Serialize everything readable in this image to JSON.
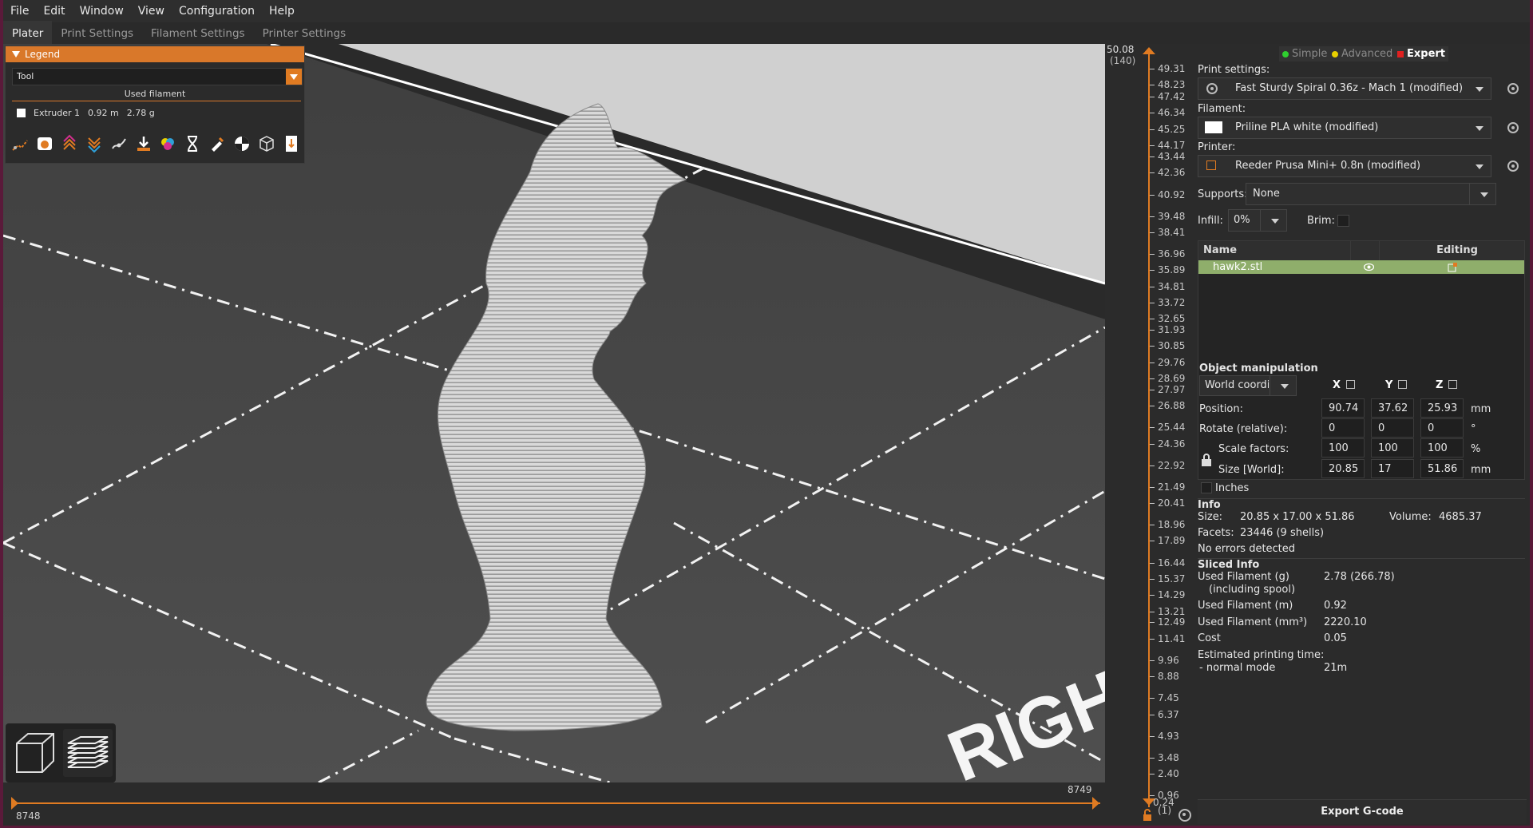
{
  "menu": [
    "File",
    "Edit",
    "Window",
    "View",
    "Configuration",
    "Help"
  ],
  "tabs": [
    "Plater",
    "Print Settings",
    "Filament Settings",
    "Printer Settings"
  ],
  "legend": {
    "title": "Legend",
    "view_type": "Tool",
    "used_filament_label": "Used filament",
    "extruder": {
      "name": "Extruder 1",
      "length": "0.92 m",
      "weight": "2.78 g",
      "color": "#ffffff"
    },
    "icons": [
      "travel-icon",
      "wipe-icon",
      "retractions-icon",
      "deretractions-icon",
      "seams-icon",
      "tool-changes-icon",
      "color-changes-icon",
      "pause-prints-icon",
      "custom-gcodes-icon",
      "center-of-gravity-icon",
      "shells-icon",
      "tool-marker-icon"
    ]
  },
  "viewport": {
    "bed_text": "RIGH"
  },
  "horizontal_slider": {
    "left_value": "8748",
    "right_value": "8749"
  },
  "vertical_slider": {
    "top_value": "50.08",
    "top_layer": "(140)",
    "ticks": [
      "49.31",
      "48.23",
      "47.42",
      "46.34",
      "45.25",
      "44.17",
      "43.44",
      "42.36",
      "40.92",
      "39.48",
      "38.41",
      "36.96",
      "35.89",
      "34.81",
      "33.72",
      "32.65",
      "31.93",
      "30.85",
      "29.76",
      "28.69",
      "27.97",
      "26.88",
      "25.44",
      "24.36",
      "22.92",
      "21.49",
      "20.41",
      "18.96",
      "17.89",
      "16.44",
      "15.37",
      "14.29",
      "13.21",
      "12.49",
      "11.41",
      "9.96",
      "8.88",
      "7.45",
      "6.37",
      "4.93",
      "3.48",
      "2.40",
      "0.96"
    ],
    "bottom_value": "0.24",
    "bottom_layer": "(1)"
  },
  "sidebar": {
    "modes": [
      {
        "label": "Simple",
        "color": "#2fcf2f"
      },
      {
        "label": "Advanced",
        "color": "#e8d000"
      },
      {
        "label": "Expert",
        "color": "#e02020"
      }
    ],
    "print_settings_label": "Print settings:",
    "print_settings_value": "Fast Sturdy Spiral 0.36z - Mach 1 (modified)",
    "filament_label": "Filament:",
    "filament_value": "Priline PLA white (modified)",
    "printer_label": "Printer:",
    "printer_value": "Reeder Prusa Mini+ 0.8n (modified)",
    "supports_label": "Supports:",
    "supports_value": "None",
    "infill_label": "Infill:",
    "infill_value": "0%",
    "brim_label": "Brim:",
    "object_list": {
      "col_name": "Name",
      "col_editing": "Editing",
      "objects": [
        {
          "name": "hawk2.stl"
        }
      ]
    },
    "object_manipulation": {
      "title": "Object manipulation",
      "coord_system": "World coordinates",
      "axes": [
        "X",
        "Y",
        "Z"
      ],
      "position_label": "Position:",
      "position": [
        "90.74",
        "37.62",
        "25.93"
      ],
      "position_unit": "mm",
      "rotate_label": "Rotate (relative):",
      "rotate": [
        "0",
        "0",
        "0"
      ],
      "rotate_unit": "°",
      "scale_label": "Scale factors:",
      "scale": [
        "100",
        "100",
        "100"
      ],
      "scale_unit": "%",
      "size_label": "Size [World]:",
      "size": [
        "20.85",
        "17",
        "51.86"
      ],
      "size_unit": "mm",
      "inches_label": "Inches"
    },
    "info": {
      "title": "Info",
      "size_label": "Size:",
      "size_value": "20.85 x 17.00 x 51.86",
      "volume_label": "Volume:",
      "volume_value": "4685.37",
      "facets_label": "Facets:",
      "facets_value": "23446 (9 shells)",
      "errors": "No errors detected"
    },
    "sliced_info": {
      "title": "Sliced Info",
      "rows": [
        {
          "label": "Used Filament (g)",
          "sub": "(including spool)",
          "value": "2.78 (266.78)"
        },
        {
          "label": "Used Filament (m)",
          "value": "0.92"
        },
        {
          "label": "Used Filament (mm³)",
          "value": "2220.10"
        },
        {
          "label": "Cost",
          "value": "0.05"
        },
        {
          "label": "Estimated printing time:",
          "sub": "- normal mode",
          "value": "21m"
        }
      ]
    },
    "export_label": "Export G-code"
  },
  "colors": {
    "accent": "#e07b22",
    "selection": "#8fae6b",
    "frame": "#5a1a3a"
  }
}
